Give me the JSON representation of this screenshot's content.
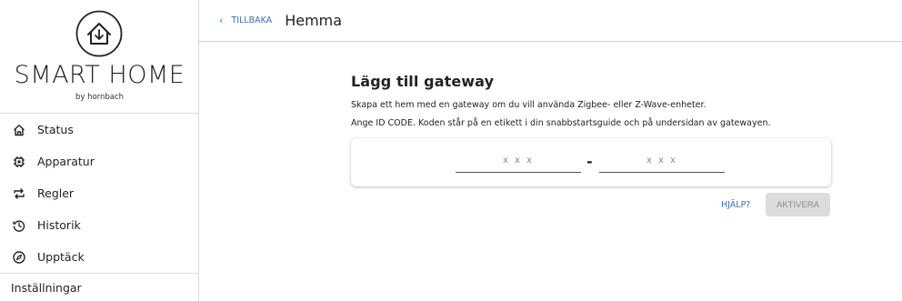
{
  "brand": {
    "title": "SMART HOME",
    "subtitle": "by hornbach",
    "icon": "house-circle-icon"
  },
  "nav": {
    "items": [
      {
        "label": "Status",
        "icon": "home-icon"
      },
      {
        "label": "Apparatur",
        "icon": "chip-icon"
      },
      {
        "label": "Regler",
        "icon": "repeat-icon"
      },
      {
        "label": "Historik",
        "icon": "history-icon"
      },
      {
        "label": "Upptäck",
        "icon": "compass-icon"
      }
    ],
    "settings_label": "Inställningar"
  },
  "header": {
    "back_label": "TILLBAKA",
    "title": "Hemma"
  },
  "main": {
    "heading": "Lägg till gateway",
    "line1": "Skapa ett hem med en gateway om du vill använda Zigbee- eller Z-Wave-enheter.",
    "line2": "Ange ID CODE. Koden står på en etikett i din snabbstartsguide och på undersidan av gatewayen.",
    "code_field_1_placeholder": "x x x",
    "code_field_2_placeholder": "x x x",
    "separator": "-",
    "help_label": "HJÄLP?",
    "activate_label": "AKTIVERA"
  }
}
